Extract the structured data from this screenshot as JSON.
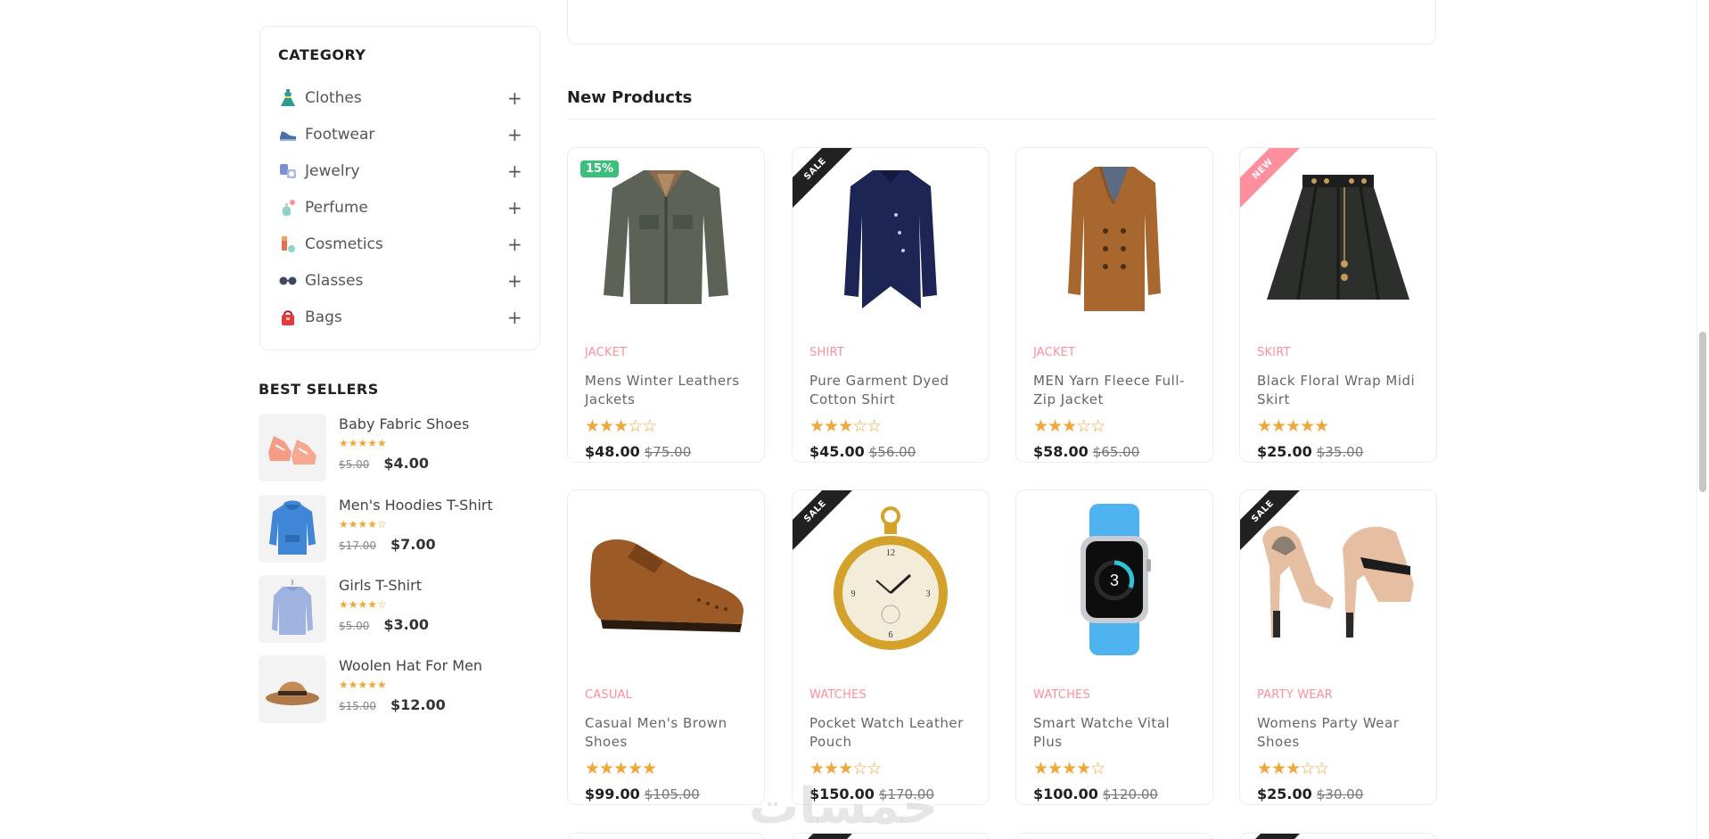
{
  "sidebar": {
    "category_title": "CATEGORY",
    "categories": [
      {
        "label": "Clothes",
        "icon": "dress-icon"
      },
      {
        "label": "Footwear",
        "icon": "shoe-icon"
      },
      {
        "label": "Jewelry",
        "icon": "watch-icon"
      },
      {
        "label": "Perfume",
        "icon": "perfume-icon"
      },
      {
        "label": "Cosmetics",
        "icon": "cosmetics-icon"
      },
      {
        "label": "Glasses",
        "icon": "glasses-icon"
      },
      {
        "label": "Bags",
        "icon": "bag-icon"
      }
    ],
    "expand_symbol": "+",
    "best_sellers_title": "BEST SELLERS",
    "best_sellers": [
      {
        "name": "Baby Fabric Shoes",
        "stars": "★★★★★",
        "rating": 5,
        "old_price": "$5.00",
        "price": "$4.00"
      },
      {
        "name": "Men's Hoodies T-Shirt",
        "stars": "★★★★☆",
        "rating": 4.5,
        "old_price": "$17.00",
        "price": "$7.00"
      },
      {
        "name": "Girls T-Shirt",
        "stars": "★★★★☆",
        "rating": 4.5,
        "old_price": "$5.00",
        "price": "$3.00"
      },
      {
        "name": "Woolen Hat For Men",
        "stars": "★★★★★",
        "rating": 5,
        "old_price": "$15.00",
        "price": "$12.00"
      }
    ]
  },
  "main": {
    "section_title": "New Products",
    "products": [
      {
        "category": "jacket",
        "title": "Mens Winter Leathers Jackets",
        "stars": "★★★☆☆",
        "rating": 3,
        "price": "$48.00",
        "old_price": "$75.00",
        "badge": "15%",
        "badge_type": "pct",
        "image": "jacket-image"
      },
      {
        "category": "shirt",
        "title": "Pure Garment Dyed Cotton Shirt",
        "stars": "★★★☆☆",
        "rating": 3,
        "price": "$45.00",
        "old_price": "$56.00",
        "badge": "SALE",
        "badge_type": "dark",
        "image": "shirt-image"
      },
      {
        "category": "jacket",
        "title": "MEN Yarn Fleece Full-Zip Jacket",
        "stars": "★★★☆☆",
        "rating": 3,
        "price": "$58.00",
        "old_price": "$65.00",
        "badge": "",
        "badge_type": "none",
        "image": "coat-image"
      },
      {
        "category": "skirt",
        "title": "Black Floral Wrap Midi Skirt",
        "stars": "★★★★★",
        "rating": 5,
        "price": "$25.00",
        "old_price": "$35.00",
        "badge": "NEW",
        "badge_type": "pink",
        "image": "skirt-image"
      },
      {
        "category": "casual",
        "title": "Casual Men's Brown Shoes",
        "stars": "★★★★★",
        "rating": 5,
        "price": "$99.00",
        "old_price": "$105.00",
        "badge": "",
        "badge_type": "none",
        "image": "brown-shoe-image"
      },
      {
        "category": "watches",
        "title": "Pocket Watch Leather Pouch",
        "stars": "★★★☆☆",
        "rating": 3,
        "price": "$150.00",
        "old_price": "$170.00",
        "badge": "SALE",
        "badge_type": "dark",
        "image": "pocket-watch-image"
      },
      {
        "category": "watches",
        "title": "Smart Watche Vital Plus",
        "stars": "★★★★☆",
        "rating": 4,
        "price": "$100.00",
        "old_price": "$120.00",
        "badge": "",
        "badge_type": "none",
        "image": "smart-watch-image"
      },
      {
        "category": "party wear",
        "title": "Womens Party Wear Shoes",
        "stars": "★★★☆☆",
        "rating": 3,
        "price": "$25.00",
        "old_price": "$30.00",
        "badge": "SALE",
        "badge_type": "dark",
        "image": "heels-image"
      }
    ]
  },
  "smartwatch_display": "3",
  "watermark": "خمسات",
  "colors": {
    "accent": "#ff8f9c",
    "star": "#f1a638",
    "badge_green": "#3dbe7c",
    "ribbon_dark": "#212121"
  }
}
